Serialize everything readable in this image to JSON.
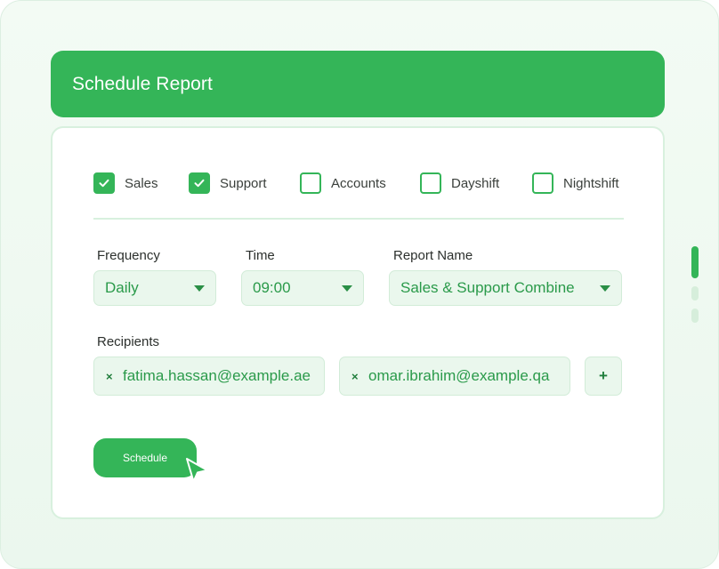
{
  "header": {
    "title": "Schedule Report"
  },
  "categories": [
    {
      "label": "Sales",
      "checked": true
    },
    {
      "label": "Support",
      "checked": true
    },
    {
      "label": "Accounts",
      "checked": false
    },
    {
      "label": "Dayshift",
      "checked": false
    },
    {
      "label": "Nightshift",
      "checked": false
    }
  ],
  "fields": {
    "frequency": {
      "label": "Frequency",
      "value": "Daily"
    },
    "time": {
      "label": "Time",
      "value": "09:00"
    },
    "report_name": {
      "label": "Report Name",
      "value": "Sales & Support Combine"
    }
  },
  "recipients": {
    "label": "Recipients",
    "items": [
      {
        "remove": "×",
        "email": "fatima.hassan@example.ae"
      },
      {
        "remove": "×",
        "email": "omar.ibrahim@example.qa"
      }
    ],
    "add_label": "+"
  },
  "actions": {
    "schedule_label": "Schedule"
  },
  "colors": {
    "accent": "#34b558",
    "field_bg": "#eaf7ed",
    "field_text": "#2a9a4a",
    "background": "#eef8f0"
  },
  "icons": {
    "check": "check-icon",
    "caret": "caret-down-icon",
    "remove": "close-icon",
    "cursor": "pointer-cursor-icon"
  }
}
